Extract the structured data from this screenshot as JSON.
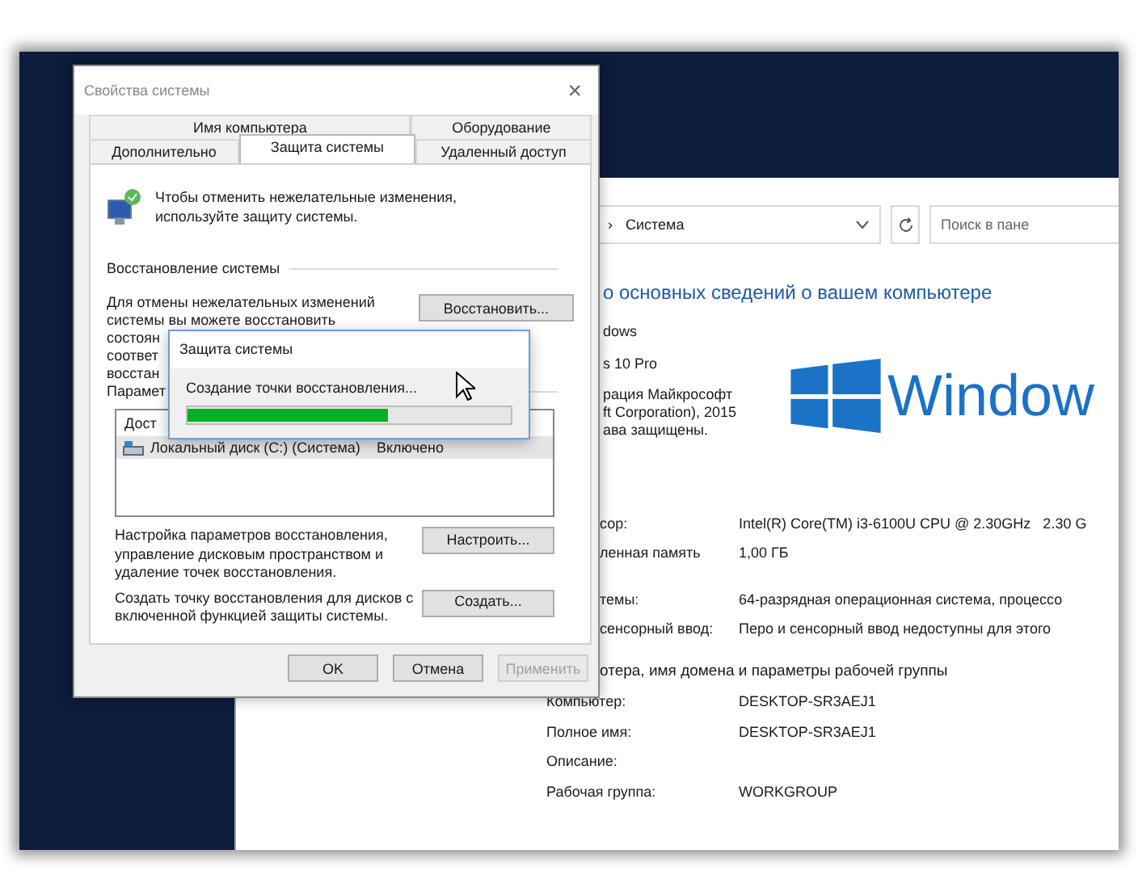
{
  "desktop_window": {
    "address": {
      "separator": "›",
      "location": "Система"
    },
    "search": {
      "placeholder": "Поиск в пане"
    },
    "heading": "о основных сведений о вашем компьютере",
    "edition_section": "dows",
    "edition_lines": [
      "s 10 Pro",
      "рация Майкрософт",
      "ft Corporation), 2015",
      "ава защищены."
    ],
    "logo_text": "Window",
    "system_rows": [
      {
        "label": "сор:",
        "value": "Intel(R) Core(TM) i3-6100U CPU @ 2.30GHz   2.30 G"
      },
      {
        "label": "ленная память",
        "value": "1,00 ГБ"
      },
      {
        "label": "темы:",
        "value": "64-разрядная операционная система, процессо"
      },
      {
        "label": "сенсорный ввод:",
        "value": "Перо и сенсорный ввод недоступны для этого"
      }
    ],
    "computer_section": "отера, имя домена и параметры рабочей группы",
    "computer_rows": [
      {
        "label": "Компьютер:",
        "value": "DESKTOP-SR3AEJ1"
      },
      {
        "label": "Полное имя:",
        "value": "DESKTOP-SR3AEJ1"
      },
      {
        "label": "Описание:"
      },
      {
        "label": "Рабочая группа:",
        "value": "WORKGROUP"
      }
    ]
  },
  "dialog": {
    "title": "Свойства системы",
    "close": "×",
    "tab_rows": [
      [
        {
          "label": "Имя компьютера",
          "selected": false
        },
        {
          "label": "Оборудование",
          "selected": false
        }
      ],
      [
        {
          "label": "Дополнительно",
          "selected": false
        },
        {
          "label": "Защита системы",
          "selected": true
        },
        {
          "label": "Удаленный доступ",
          "selected": false
        }
      ]
    ],
    "intro": "Чтобы отменить нежелательные изменения, используйте защиту системы.",
    "restore_group": "Восстановление системы",
    "restore_text_lines": [
      "Для отмены нежелательных изменений",
      "системы вы можете восстановить",
      "состоян",
      "соответ",
      "восстан"
    ],
    "restore_button": {
      "label": "Восстановить...",
      "disabled": false
    },
    "params_group": "Парамет",
    "drives": {
      "column_1": "Дост",
      "rows": [
        {
          "name": "Локальный диск (C:) (Система)",
          "status": "Включено",
          "selected": true
        }
      ]
    },
    "configure_text": "Настройка параметров восстановления, управление дисковым пространством и удаление точек восстановления.",
    "configure_button": {
      "label": "Настроить...",
      "disabled": false
    },
    "create_text": "Создать точку восстановления для дисков с включенной функцией защиты системы.",
    "create_button": {
      "label": "Создать...",
      "disabled": false
    },
    "buttons": [
      {
        "label": "OK",
        "disabled": false
      },
      {
        "label": "Отмена",
        "disabled": false
      },
      {
        "label": "Применить",
        "disabled": true
      }
    ]
  },
  "progress_dialog": {
    "title": "Защита системы",
    "message": "Создание точки восстановления...",
    "level": 0.62
  }
}
